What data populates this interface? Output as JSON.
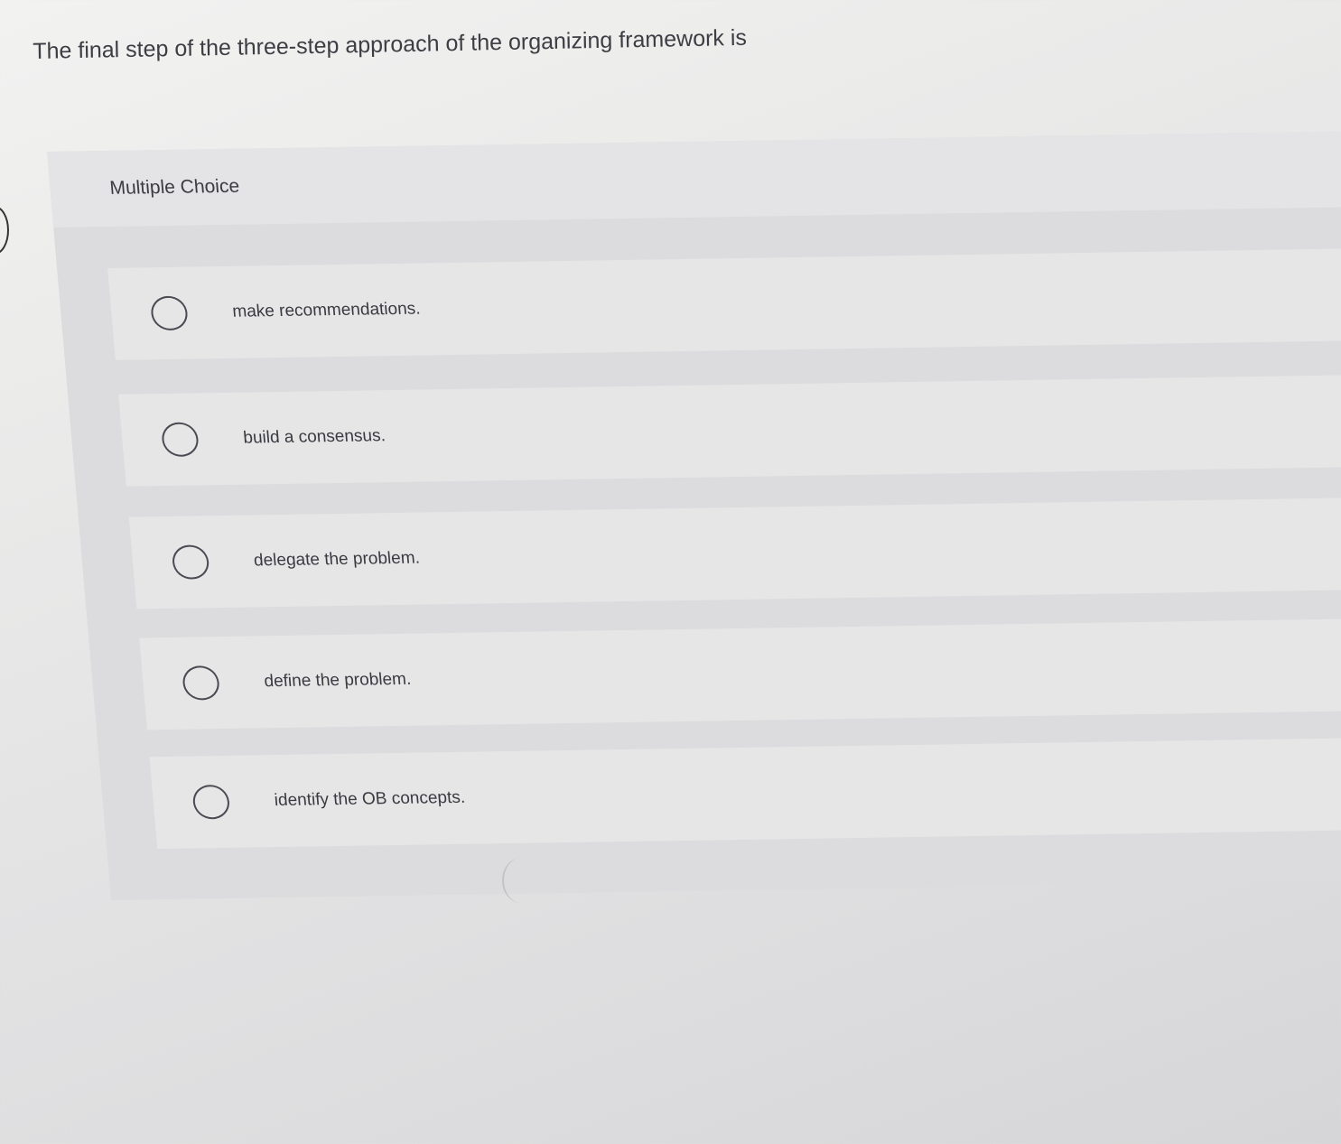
{
  "question": {
    "text": "The final step of the three-step approach of the organizing framework is"
  },
  "answer_area": {
    "type_label": "Multiple Choice",
    "options": [
      {
        "label": "make recommendations."
      },
      {
        "label": "build a consensus."
      },
      {
        "label": "delegate the problem."
      },
      {
        "label": "define the problem."
      },
      {
        "label": "identify the OB concepts."
      }
    ]
  }
}
